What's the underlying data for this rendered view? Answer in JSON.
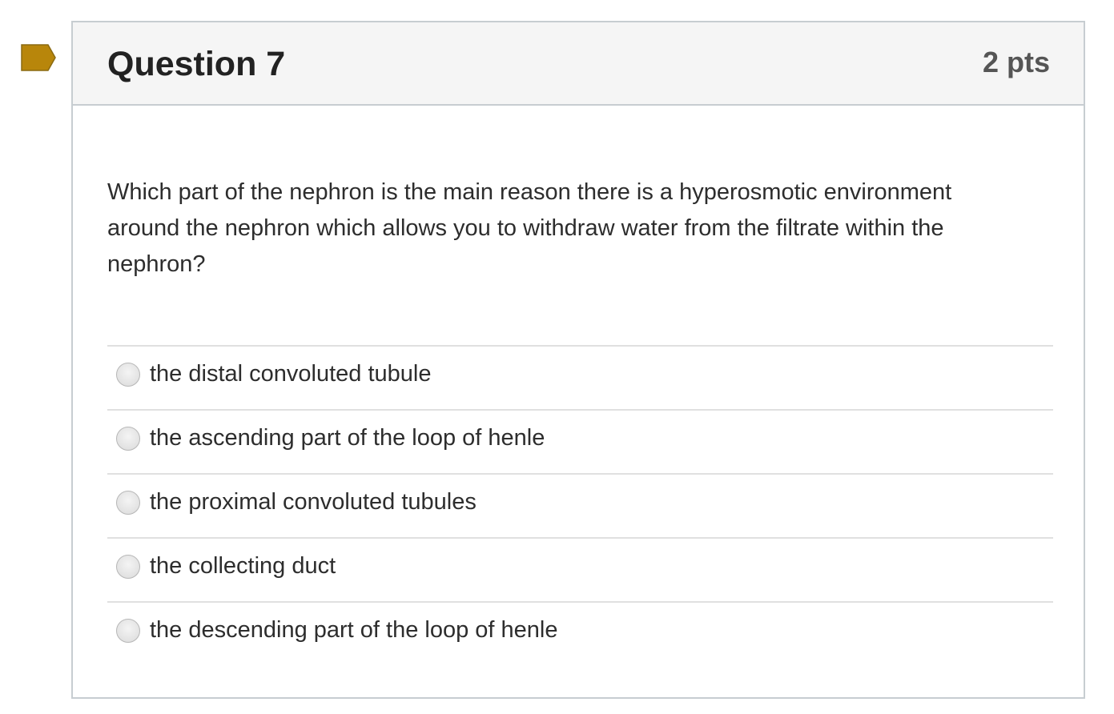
{
  "question": {
    "flag_icon": "bookmark-flag-icon",
    "flag_color": "#B8860B",
    "title": "Question 7",
    "points": "2 pts",
    "text": "Which part of the nephron is the main reason there is a hyperosmotic environment around the nephron which allows you to withdraw water from the filtrate within the nephron?",
    "answers": [
      {
        "label": "the distal convoluted tubule",
        "selected": false
      },
      {
        "label": "the ascending part of the loop of henle",
        "selected": false
      },
      {
        "label": "the proximal convoluted tubules",
        "selected": false
      },
      {
        "label": "the collecting duct",
        "selected": false
      },
      {
        "label": "the descending part of the loop of henle",
        "selected": false
      }
    ]
  },
  "colors": {
    "header_bg": "#F5F5F5",
    "border": "#C7CDD1",
    "divider": "#E0E0E0"
  }
}
